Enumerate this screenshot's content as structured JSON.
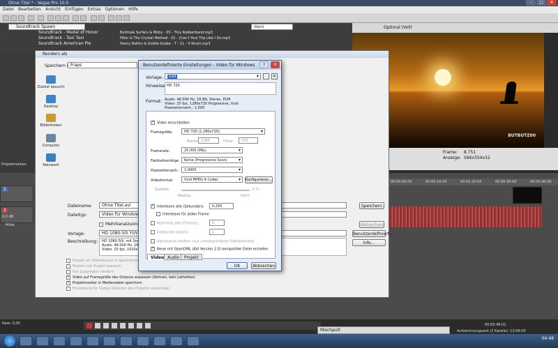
{
  "app": {
    "title": "Ohne Titel * - Vegas Pro 10.0",
    "menu": [
      "Datei",
      "Bearbeiten",
      "Ansicht",
      "Einfügen",
      "Extras",
      "Optionen",
      "Hilfe"
    ]
  },
  "explorer": {
    "folder": "Soundtrack Spawn",
    "col1": [
      "Soundtrack - Medal of Honor",
      "Soundtrack - Taxi Taxi",
      "Soundtrack American Pie"
    ],
    "col2": [
      "Butthole Surfers & Moby - 05 - Tiny Rubberband.mp3",
      "Filter & The Crystal Method - 01 - (Can't You) Trip Like I Do.mp3",
      "Henry Rollins & Goldie Grabe - T - 11 - 4 Strain.mp3"
    ],
    "preview_selector": "(Kein)"
  },
  "preview": {
    "mode": "Optimal (Voll)",
    "watermark": "BUTBUTZ00",
    "frame_label": "Frame:",
    "frame_value": "8.751",
    "display_label": "Anzeige:",
    "display_value": "566x354x32"
  },
  "timeline": {
    "tracks": [
      "1",
      "2"
    ],
    "level": "0,0 dB",
    "pan": "Mitte",
    "rate": "Rate: 0,00",
    "timecode": "00:05:48,01",
    "record_time": "Aufzeichnungszeit (2 Kanäle): 13:09:00",
    "ruler": [
      "00:04:49:29",
      "00:05:00:00",
      "00:05:10:00",
      "00:05:20:00",
      "00:05:30:00",
      "00:05:40:00"
    ],
    "markers": [
      "50p",
      "00p",
      "00p"
    ]
  },
  "mixer": {
    "title": "Mischpult"
  },
  "clock": {
    "time": "04:48"
  },
  "left_panel": {
    "projekt_tab": "Projektmedien"
  },
  "render_dialog": {
    "title": "Rendern als",
    "save_in_label": "Speichern in:",
    "save_in_value": "Fraps",
    "places": [
      "Zuletzt besucht",
      "Desktop",
      "Bibliotheken",
      "Computer",
      "Netzwerk"
    ],
    "filename_label": "Dateiname:",
    "filename_value": "Ohne Titel.avi",
    "filetype_label": "Dateityp:",
    "filetype_value": "Video für Windows (*.avi)",
    "multichannel_label": "Mehrkanalzuordnung",
    "template_label": "Vorlage:",
    "template_value": "HD 1080-50i YUV",
    "description_label": "Beschreibung:",
    "description_lines": [
      "HD 1080-50i, mit Sony YUV",
      "Audio: 48.000 Hz, 16 Bit,",
      "Video: 25 fps, 1920x1080"
    ],
    "save_btn": "Speichern",
    "cancel_btn": "Abbrechen",
    "custom_btn": "Benutzerdefiniert...",
    "info_btn": "Info...",
    "options": [
      {
        "label": "Projekt als Pfadreferenz in gerenderten Medien speichern",
        "checked": false,
        "enabled": false
      },
      {
        "label": "Medien mit Projekt kopieren",
        "checked": false,
        "enabled": false
      },
      {
        "label": "Nur Loopregion rendern",
        "checked": false,
        "enabled": false
      },
      {
        "label": "Video auf Framegröße des Outputs anpassen (dehnen, kein Letterbox)",
        "checked": true,
        "enabled": true
      },
      {
        "label": "Projektmarker in Mediendatei speichern",
        "checked": true,
        "enabled": true
      },
      {
        "label": "Einstellung für Output-Rotation des Projekts verwenden",
        "checked": false,
        "enabled": false
      }
    ]
  },
  "custom_dialog": {
    "title": "Benutzerdefinierte Einstellungen - Video für Windows",
    "template_label": "Vorlage:",
    "template_value": "xvid",
    "notes_label": "Hinweise:",
    "notes_value": "HD 720.",
    "format_label": "Format:",
    "format_lines": [
      "Audio: 48.000 Hz, 16 Bit, Stereo, PCM",
      "Video: 25 fps, 1280x720 Progressive, Xvid",
      "Pixelseitenverh.: 1,000"
    ],
    "include_video_label": "Video einschließen",
    "framesize_label": "Framegröße:",
    "framesize_value": "HD 720 (1.280x720)",
    "width_label": "Breite:",
    "width_value": "1280",
    "height_label": "Höhe:",
    "height_value": "720",
    "framerate_label": "Framerate:",
    "framerate_value": "25,000 (PAL)",
    "field_order_label": "Fieldreihenfolge:",
    "field_order_value": "Keine (Progressive Scan)",
    "pixel_aspect_label": "Pixelseitenverh.:",
    "pixel_aspect_value": "1,0000",
    "videoformat_label": "Videoformat:",
    "videoformat_value": "Xvid MPEG-4 Codec",
    "configure_btn": "Konfigurieren...",
    "quality_label": "Qualität:",
    "quality_low": "Niedrig",
    "quality_high": "Hoch",
    "quality_value": "0 %",
    "interleave_label": "Interleave alle (Sekunden):",
    "interleave_value": "0,250",
    "interleave_frame_label": "Interleave für jeden Frame",
    "keyframe_label": "Keyframe alle (Frames):",
    "keyframe_value": "0",
    "datarate_label": "Datenrate (kbit/s):",
    "datarate_value": "1",
    "alpha_label": "Alphakanal rendern (nur unkomprimierte Videoformate)",
    "opendml_label": "Neue mit OpenDML (AVI Version 2.0) kompatible Datei erstellen",
    "tabs": [
      "Video",
      "Audio",
      "Projekt"
    ],
    "ok_btn": "OK",
    "cancel_btn": "Abbrechen"
  }
}
